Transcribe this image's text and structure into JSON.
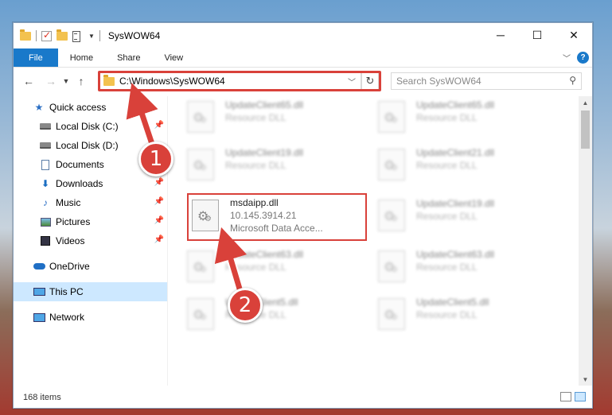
{
  "window": {
    "title": "SysWOW64"
  },
  "ribbon": {
    "tabs": [
      "File",
      "Home",
      "Share",
      "View"
    ]
  },
  "address": {
    "path": "C:\\Windows\\SysWOW64"
  },
  "search": {
    "placeholder": "Search SysWOW64"
  },
  "sidebar": {
    "items": [
      {
        "label": "Quick access",
        "icon": "star-icon",
        "pinned": false
      },
      {
        "label": "Local Disk (C:)",
        "icon": "disk-icon",
        "pinned": true
      },
      {
        "label": "Local Disk (D:)",
        "icon": "disk-icon",
        "pinned": false
      },
      {
        "label": "Documents",
        "icon": "documents-icon",
        "pinned": true
      },
      {
        "label": "Downloads",
        "icon": "download-icon",
        "pinned": true
      },
      {
        "label": "Music",
        "icon": "music-icon",
        "pinned": true
      },
      {
        "label": "Pictures",
        "icon": "pictures-icon",
        "pinned": true
      },
      {
        "label": "Videos",
        "icon": "videos-icon",
        "pinned": true
      },
      {
        "label": "OneDrive",
        "icon": "onedrive-icon",
        "pinned": false
      },
      {
        "label": "This PC",
        "icon": "pc-icon",
        "pinned": false,
        "selected": true
      },
      {
        "label": "Network",
        "icon": "network-icon",
        "pinned": false
      }
    ]
  },
  "files": {
    "left": [
      {
        "name": "UpdateClient65.dll",
        "desc": "Resource DLL"
      },
      {
        "name": "UpdateClient19.dll",
        "desc": "Resource DLL"
      },
      {
        "name": "msdaipp.dll",
        "version": "10.145.3914.21",
        "desc": "Microsoft Data Acce..."
      },
      {
        "name": "UpdateClient63.dll",
        "desc": "Resource DLL"
      },
      {
        "name": "UpdateClient5.dll",
        "desc": "Resource DLL"
      }
    ],
    "right": [
      {
        "name": "UpdateClient65.dll",
        "desc": "Resource DLL"
      },
      {
        "name": "UpdateClient21.dll",
        "desc": "Resource DLL"
      },
      {
        "name": "UpdateClient19.dll",
        "desc": "Resource DLL"
      },
      {
        "name": "UpdateClient63.dll",
        "desc": "Resource DLL"
      },
      {
        "name": "UpdateClient5.dll",
        "desc": "Resource DLL"
      }
    ]
  },
  "status": {
    "count": "168 items"
  },
  "callouts": [
    "1",
    "2"
  ],
  "colors": {
    "accent": "#1979ca",
    "highlight": "#d9413a",
    "selected": "#cde8ff"
  }
}
